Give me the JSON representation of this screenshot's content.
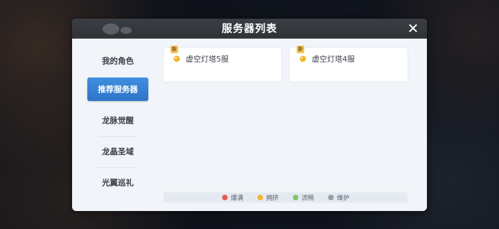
{
  "dialog": {
    "title": "服务器列表",
    "close_symbol": "✕"
  },
  "sidebar": {
    "items": [
      {
        "label": "我的角色",
        "active": false
      },
      {
        "label": "推荐服务器",
        "active": true
      },
      {
        "label": "龙脉觉醒",
        "active": false
      },
      {
        "label": "龙晶圣域",
        "active": false
      },
      {
        "label": "光翼巡礼",
        "active": false
      }
    ]
  },
  "servers": [
    {
      "name": "虚空灯塔5服",
      "badge": "新",
      "status": "crowded",
      "status_color": "#f0b530"
    },
    {
      "name": "虚空灯塔4服",
      "badge": "新",
      "status": "crowded",
      "status_color": "#f0b530"
    }
  ],
  "legend": [
    {
      "label": "爆满",
      "color": "#e85a4f",
      "icon": "red-status-icon"
    },
    {
      "label": "拥挤",
      "color": "#f0b530",
      "icon": "yellow-status-icon"
    },
    {
      "label": "流畅",
      "color": "#7cc766",
      "icon": "green-status-icon"
    },
    {
      "label": "维护",
      "color": "#9a9ea6",
      "icon": "gray-status-icon"
    }
  ],
  "colors": {
    "accent": "#3d8fe0",
    "titlebar": "#33373c"
  }
}
